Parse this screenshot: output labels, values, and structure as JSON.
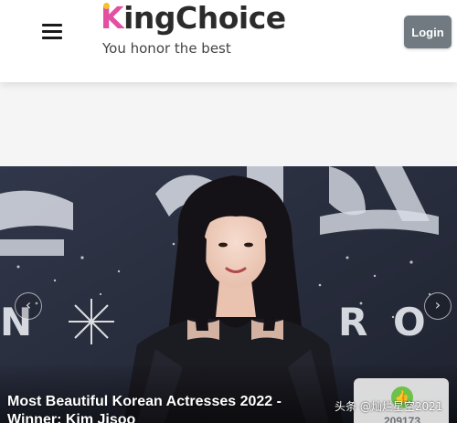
{
  "header": {
    "logo_text": "KingChoice",
    "tagline": "You honor the best",
    "login_label": "Login",
    "menu_icon": "hamburger-menu-icon"
  },
  "carousel": {
    "prev_icon": "chevron-left-icon",
    "prev_glyph": "‹",
    "next_icon": "chevron-right-icon",
    "next_glyph": "›",
    "slide": {
      "caption": "Most Beautiful Korean Actresses 2022 - Winner: Kim Jisoo",
      "vote_icon": "thumbs-up-icon",
      "vote_count": "209173"
    }
  },
  "watermark": "头条 @灿烂星空2021",
  "colors": {
    "logo_k": "#e34fa2",
    "logo_dot": "#f6c229",
    "login_bg": "#707a80",
    "vote_green": "#6cc24a"
  }
}
